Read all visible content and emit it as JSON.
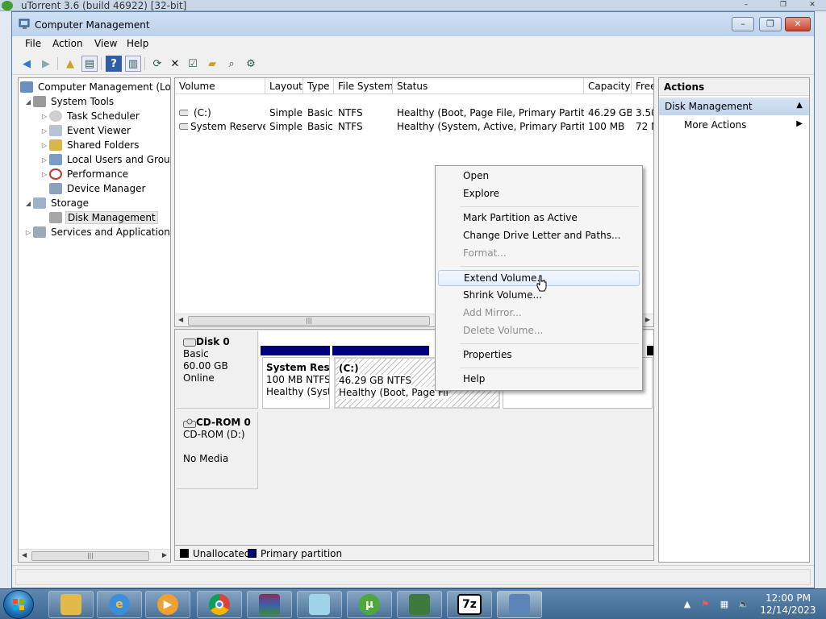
{
  "background_window": {
    "title": "uTorrent 3.6  (build 46922) [32-bit]"
  },
  "window": {
    "title": "Computer Management",
    "controls": {
      "minimize": "–",
      "maximize": "❐",
      "close": "✕"
    }
  },
  "menu": [
    "File",
    "Action",
    "View",
    "Help"
  ],
  "toolbar_icons": [
    "back-icon",
    "forward-icon",
    "up-folder-icon",
    "show-hide-tree-icon",
    "help-icon",
    "show-hide-action-pane-icon",
    "refresh-icon",
    "delete-icon",
    "properties-icon",
    "open-icon",
    "search-disk-icon",
    "settings-icon"
  ],
  "tree": {
    "root": "Computer Management (Local",
    "system_tools": "System Tools",
    "task_scheduler": "Task Scheduler",
    "event_viewer": "Event Viewer",
    "shared_folders": "Shared Folders",
    "local_users": "Local Users and Groups",
    "performance": "Performance",
    "device_manager": "Device Manager",
    "storage": "Storage",
    "disk_management": "Disk Management",
    "services": "Services and Applications"
  },
  "volumes": {
    "columns": [
      "Volume",
      "Layout",
      "Type",
      "File System",
      "Status",
      "Capacity",
      "Free"
    ],
    "rows": [
      [
        "(C:)",
        "Simple",
        "Basic",
        "NTFS",
        "Healthy (Boot, Page File, Primary Partition)",
        "46.29 GB",
        "3.50"
      ],
      [
        "System Reserved",
        "Simple",
        "Basic",
        "NTFS",
        "Healthy (System, Active, Primary Partition)",
        "100 MB",
        "72 M"
      ]
    ]
  },
  "disks": {
    "disk0": {
      "name": "Disk 0",
      "type": "Basic",
      "size": "60.00 GB",
      "state": "Online",
      "partitions": [
        {
          "name": "System Reser",
          "size": "100 MB NTFS",
          "status": "Healthy (Syste"
        },
        {
          "name": "(C:)",
          "size": "46.29 GB NTFS",
          "status": "Healthy (Boot, Page Fil"
        }
      ]
    },
    "cdrom0": {
      "name": "CD-ROM 0",
      "drive": "CD-ROM (D:)",
      "state": "No Media"
    }
  },
  "legend": {
    "unallocated": "Unallocated",
    "primary": "Primary partition",
    "unallocated_color": "#000000",
    "primary_color": "#00007f"
  },
  "actions": {
    "header": "Actions",
    "section": "Disk Management",
    "more": "More Actions"
  },
  "context_menu": {
    "open": "Open",
    "explore": "Explore",
    "mark_active": "Mark Partition as Active",
    "change_letter": "Change Drive Letter and Paths...",
    "format": "Format...",
    "extend": "Extend Volume...",
    "shrink": "Shrink Volume...",
    "add_mirror": "Add Mirror...",
    "delete": "Delete Volume...",
    "properties": "Properties",
    "help": "Help"
  },
  "taskbar": {
    "apps": [
      "file-explorer-icon",
      "internet-explorer-icon",
      "media-player-icon",
      "chrome-icon",
      "winrar-icon",
      "notepad-icon",
      "utorrent-icon",
      "network-card-icon",
      "7zip-icon",
      "computer-management-icon"
    ],
    "sevenzip_label": "7z",
    "time": "12:00 PM",
    "date": "12/14/2023"
  }
}
